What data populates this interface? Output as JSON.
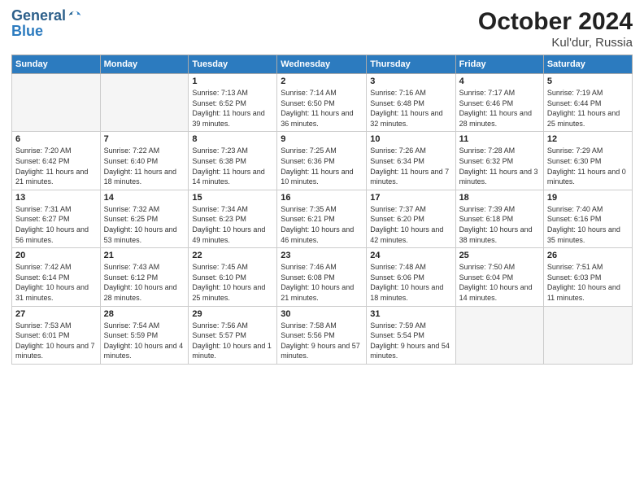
{
  "header": {
    "logo_line1": "General",
    "logo_line2": "Blue",
    "month": "October 2024",
    "location": "Kul'dur, Russia"
  },
  "weekdays": [
    "Sunday",
    "Monday",
    "Tuesday",
    "Wednesday",
    "Thursday",
    "Friday",
    "Saturday"
  ],
  "weeks": [
    [
      {
        "day": "",
        "sunrise": "",
        "sunset": "",
        "daylight": "",
        "empty": true
      },
      {
        "day": "",
        "sunrise": "",
        "sunset": "",
        "daylight": "",
        "empty": true
      },
      {
        "day": "1",
        "sunrise": "Sunrise: 7:13 AM",
        "sunset": "Sunset: 6:52 PM",
        "daylight": "Daylight: 11 hours and 39 minutes."
      },
      {
        "day": "2",
        "sunrise": "Sunrise: 7:14 AM",
        "sunset": "Sunset: 6:50 PM",
        "daylight": "Daylight: 11 hours and 36 minutes."
      },
      {
        "day": "3",
        "sunrise": "Sunrise: 7:16 AM",
        "sunset": "Sunset: 6:48 PM",
        "daylight": "Daylight: 11 hours and 32 minutes."
      },
      {
        "day": "4",
        "sunrise": "Sunrise: 7:17 AM",
        "sunset": "Sunset: 6:46 PM",
        "daylight": "Daylight: 11 hours and 28 minutes."
      },
      {
        "day": "5",
        "sunrise": "Sunrise: 7:19 AM",
        "sunset": "Sunset: 6:44 PM",
        "daylight": "Daylight: 11 hours and 25 minutes."
      }
    ],
    [
      {
        "day": "6",
        "sunrise": "Sunrise: 7:20 AM",
        "sunset": "Sunset: 6:42 PM",
        "daylight": "Daylight: 11 hours and 21 minutes."
      },
      {
        "day": "7",
        "sunrise": "Sunrise: 7:22 AM",
        "sunset": "Sunset: 6:40 PM",
        "daylight": "Daylight: 11 hours and 18 minutes."
      },
      {
        "day": "8",
        "sunrise": "Sunrise: 7:23 AM",
        "sunset": "Sunset: 6:38 PM",
        "daylight": "Daylight: 11 hours and 14 minutes."
      },
      {
        "day": "9",
        "sunrise": "Sunrise: 7:25 AM",
        "sunset": "Sunset: 6:36 PM",
        "daylight": "Daylight: 11 hours and 10 minutes."
      },
      {
        "day": "10",
        "sunrise": "Sunrise: 7:26 AM",
        "sunset": "Sunset: 6:34 PM",
        "daylight": "Daylight: 11 hours and 7 minutes."
      },
      {
        "day": "11",
        "sunrise": "Sunrise: 7:28 AM",
        "sunset": "Sunset: 6:32 PM",
        "daylight": "Daylight: 11 hours and 3 minutes."
      },
      {
        "day": "12",
        "sunrise": "Sunrise: 7:29 AM",
        "sunset": "Sunset: 6:30 PM",
        "daylight": "Daylight: 11 hours and 0 minutes."
      }
    ],
    [
      {
        "day": "13",
        "sunrise": "Sunrise: 7:31 AM",
        "sunset": "Sunset: 6:27 PM",
        "daylight": "Daylight: 10 hours and 56 minutes."
      },
      {
        "day": "14",
        "sunrise": "Sunrise: 7:32 AM",
        "sunset": "Sunset: 6:25 PM",
        "daylight": "Daylight: 10 hours and 53 minutes."
      },
      {
        "day": "15",
        "sunrise": "Sunrise: 7:34 AM",
        "sunset": "Sunset: 6:23 PM",
        "daylight": "Daylight: 10 hours and 49 minutes."
      },
      {
        "day": "16",
        "sunrise": "Sunrise: 7:35 AM",
        "sunset": "Sunset: 6:21 PM",
        "daylight": "Daylight: 10 hours and 46 minutes."
      },
      {
        "day": "17",
        "sunrise": "Sunrise: 7:37 AM",
        "sunset": "Sunset: 6:20 PM",
        "daylight": "Daylight: 10 hours and 42 minutes."
      },
      {
        "day": "18",
        "sunrise": "Sunrise: 7:39 AM",
        "sunset": "Sunset: 6:18 PM",
        "daylight": "Daylight: 10 hours and 38 minutes."
      },
      {
        "day": "19",
        "sunrise": "Sunrise: 7:40 AM",
        "sunset": "Sunset: 6:16 PM",
        "daylight": "Daylight: 10 hours and 35 minutes."
      }
    ],
    [
      {
        "day": "20",
        "sunrise": "Sunrise: 7:42 AM",
        "sunset": "Sunset: 6:14 PM",
        "daylight": "Daylight: 10 hours and 31 minutes."
      },
      {
        "day": "21",
        "sunrise": "Sunrise: 7:43 AM",
        "sunset": "Sunset: 6:12 PM",
        "daylight": "Daylight: 10 hours and 28 minutes."
      },
      {
        "day": "22",
        "sunrise": "Sunrise: 7:45 AM",
        "sunset": "Sunset: 6:10 PM",
        "daylight": "Daylight: 10 hours and 25 minutes."
      },
      {
        "day": "23",
        "sunrise": "Sunrise: 7:46 AM",
        "sunset": "Sunset: 6:08 PM",
        "daylight": "Daylight: 10 hours and 21 minutes."
      },
      {
        "day": "24",
        "sunrise": "Sunrise: 7:48 AM",
        "sunset": "Sunset: 6:06 PM",
        "daylight": "Daylight: 10 hours and 18 minutes."
      },
      {
        "day": "25",
        "sunrise": "Sunrise: 7:50 AM",
        "sunset": "Sunset: 6:04 PM",
        "daylight": "Daylight: 10 hours and 14 minutes."
      },
      {
        "day": "26",
        "sunrise": "Sunrise: 7:51 AM",
        "sunset": "Sunset: 6:03 PM",
        "daylight": "Daylight: 10 hours and 11 minutes."
      }
    ],
    [
      {
        "day": "27",
        "sunrise": "Sunrise: 7:53 AM",
        "sunset": "Sunset: 6:01 PM",
        "daylight": "Daylight: 10 hours and 7 minutes."
      },
      {
        "day": "28",
        "sunrise": "Sunrise: 7:54 AM",
        "sunset": "Sunset: 5:59 PM",
        "daylight": "Daylight: 10 hours and 4 minutes."
      },
      {
        "day": "29",
        "sunrise": "Sunrise: 7:56 AM",
        "sunset": "Sunset: 5:57 PM",
        "daylight": "Daylight: 10 hours and 1 minute."
      },
      {
        "day": "30",
        "sunrise": "Sunrise: 7:58 AM",
        "sunset": "Sunset: 5:56 PM",
        "daylight": "Daylight: 9 hours and 57 minutes."
      },
      {
        "day": "31",
        "sunrise": "Sunrise: 7:59 AM",
        "sunset": "Sunset: 5:54 PM",
        "daylight": "Daylight: 9 hours and 54 minutes."
      },
      {
        "day": "",
        "sunrise": "",
        "sunset": "",
        "daylight": "",
        "empty": true
      },
      {
        "day": "",
        "sunrise": "",
        "sunset": "",
        "daylight": "",
        "empty": true
      }
    ]
  ],
  "colors": {
    "header_bg": "#2c7bbf",
    "header_text": "#ffffff",
    "row_alt": "#f0f4f8"
  }
}
